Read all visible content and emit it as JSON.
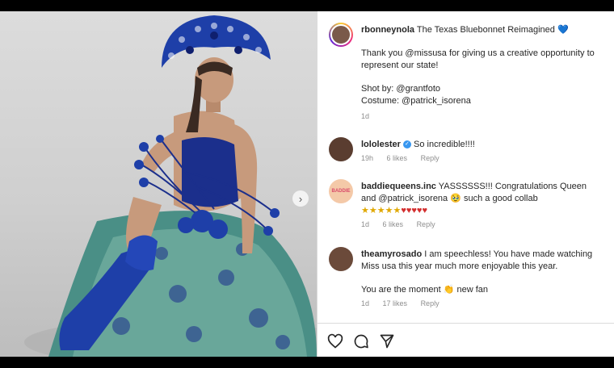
{
  "post": {
    "username": "rbonneynola",
    "caption": "The Texas Bluebonnet Reimagined",
    "caption_emoji": "💙",
    "thanks": "Thank you @missusa for giving us a creative opportunity to represent our state!",
    "shot_by": "Shot by: @grantfoto",
    "costume": "Costume: @patrick_isorena",
    "time": "1d"
  },
  "comments": [
    {
      "username": "lololester",
      "text": "So incredible!!!!",
      "time": "19h",
      "likes": "6 likes",
      "reply": "Reply"
    },
    {
      "username": "baddiequeens.inc",
      "text": "YASSSSSS!!! Congratulations Queen and @patrick_isorena",
      "text2": "such a good collab",
      "time": "1d",
      "likes": "6 likes",
      "reply": "Reply",
      "avatar_text": "BADDIE"
    },
    {
      "username": "theamyrosado",
      "text": "I am speechless! You have made watching Miss usa this year much more enjoyable this year.",
      "text2": "You are the moment",
      "text3": "new fan",
      "time": "1d",
      "likes": "17 likes",
      "reply": "Reply"
    }
  ],
  "icons": {
    "like": "heart-icon",
    "comment": "comment-icon",
    "share": "share-icon",
    "next": "chevron-right-icon"
  },
  "colors": {
    "accent_blue": "#3897f0",
    "costume_navy": "#1b2f8c",
    "costume_teal": "#4a8f86"
  }
}
